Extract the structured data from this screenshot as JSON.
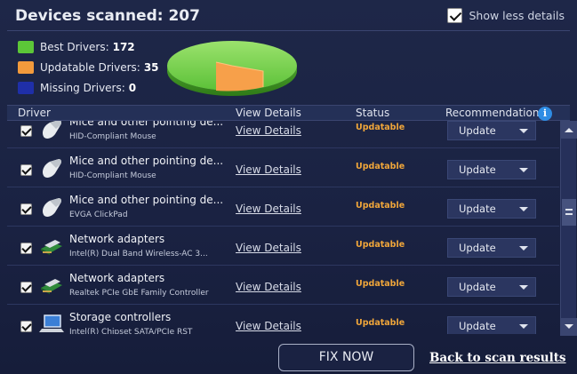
{
  "header": {
    "title": "Devices scanned: 207",
    "show_less_label": "Show less details",
    "show_less_checked": true
  },
  "legend": [
    {
      "label": "Best Drivers:",
      "count": "172",
      "color": "#5cc638"
    },
    {
      "label": "Updatable Drivers:",
      "count": "35",
      "color": "#f39a3c"
    },
    {
      "label": "Missing Drivers:",
      "count": "0",
      "color": "#1f2fa8"
    }
  ],
  "pie": {
    "best": 172,
    "updatable": 35,
    "missing": 0,
    "colors": {
      "best": "#63c93d",
      "updatable": "#f7a04a"
    }
  },
  "table": {
    "headers": {
      "driver": "Driver",
      "view_details": "View Details",
      "status": "Status",
      "recommendation": "Recommendation"
    },
    "rows": [
      {
        "name": "Mice and other pointing de...",
        "sub": "HID-Compliant Mouse",
        "view": "View Details",
        "status": "Updatable",
        "rec": "Update",
        "icon": "mouse-icon"
      },
      {
        "name": "Mice and other pointing de...",
        "sub": "HID-Compliant Mouse",
        "view": "View Details",
        "status": "Updatable",
        "rec": "Update",
        "icon": "mouse-icon"
      },
      {
        "name": "Mice and other pointing de...",
        "sub": "EVGA ClickPad",
        "view": "View Details",
        "status": "Updatable",
        "rec": "Update",
        "icon": "mouse-icon"
      },
      {
        "name": "Network adapters",
        "sub": "Intel(R) Dual Band Wireless-AC 3...",
        "view": "View Details",
        "status": "Updatable",
        "rec": "Update",
        "icon": "network-adapter-icon"
      },
      {
        "name": "Network adapters",
        "sub": "Realtek PCIe GbE Family Controller",
        "view": "View Details",
        "status": "Updatable",
        "rec": "Update",
        "icon": "network-adapter-icon"
      },
      {
        "name": "Storage controllers",
        "sub": "Intel(R) Chipset SATA/PCIe RST",
        "view": "View Details",
        "status": "Updatable",
        "rec": "Update",
        "icon": "storage-controller-icon"
      }
    ]
  },
  "footer": {
    "fix_now": "FIX NOW",
    "back_link": "Back to scan results"
  }
}
